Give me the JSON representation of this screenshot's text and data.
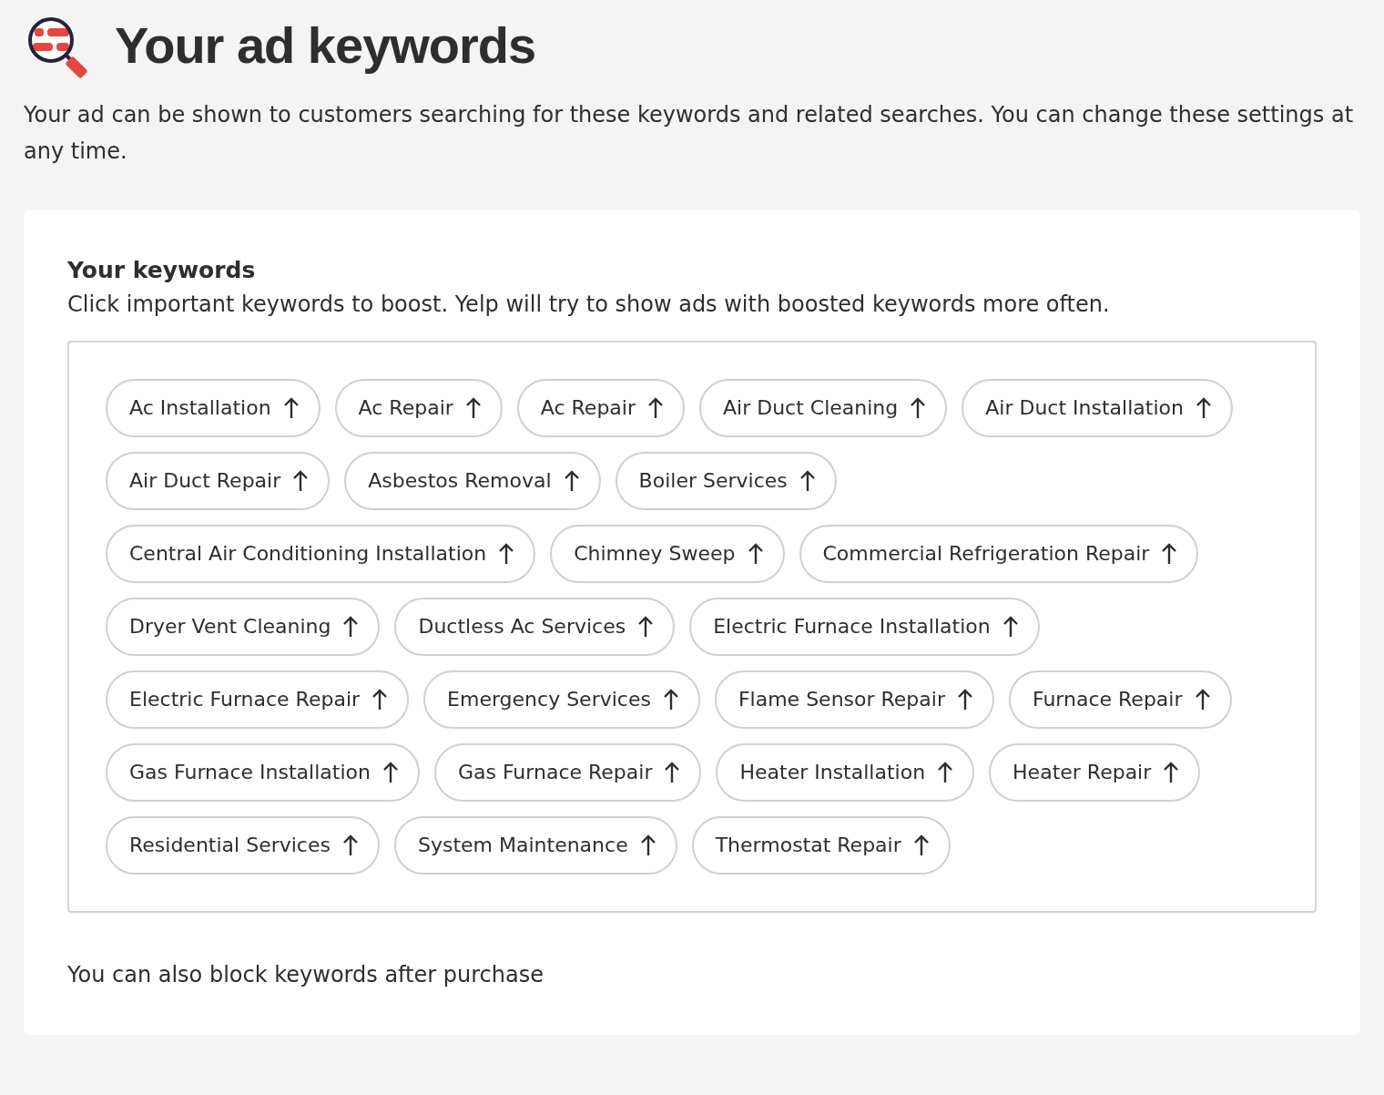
{
  "header": {
    "title": "Your ad keywords",
    "description": "Your ad can be shown to customers searching for these keywords and related searches. You can change these settings at any time."
  },
  "keywords_card": {
    "heading": "Your keywords",
    "instruction": "Click important keywords to boost. Yelp will try to show ads with boosted keywords more often.",
    "keywords": [
      "Ac Installation",
      "Ac Repair",
      "Ac Repair",
      "Air Duct Cleaning",
      "Air Duct Installation",
      "Air Duct Repair",
      "Asbestos Removal",
      "Boiler Services",
      "Central Air Conditioning Installation",
      "Chimney Sweep",
      "Commercial Refrigeration Repair",
      "Dryer Vent Cleaning",
      "Ductless Ac Services",
      "Electric Furnace Installation",
      "Electric Furnace Repair",
      "Emergency Services",
      "Flame Sensor Repair",
      "Furnace Repair",
      "Gas Furnace Installation",
      "Gas Furnace Repair",
      "Heater Installation",
      "Heater Repair",
      "Residential Services",
      "System Maintenance",
      "Thermostat Repair"
    ],
    "footer_note": "You can also block keywords after purchase"
  }
}
